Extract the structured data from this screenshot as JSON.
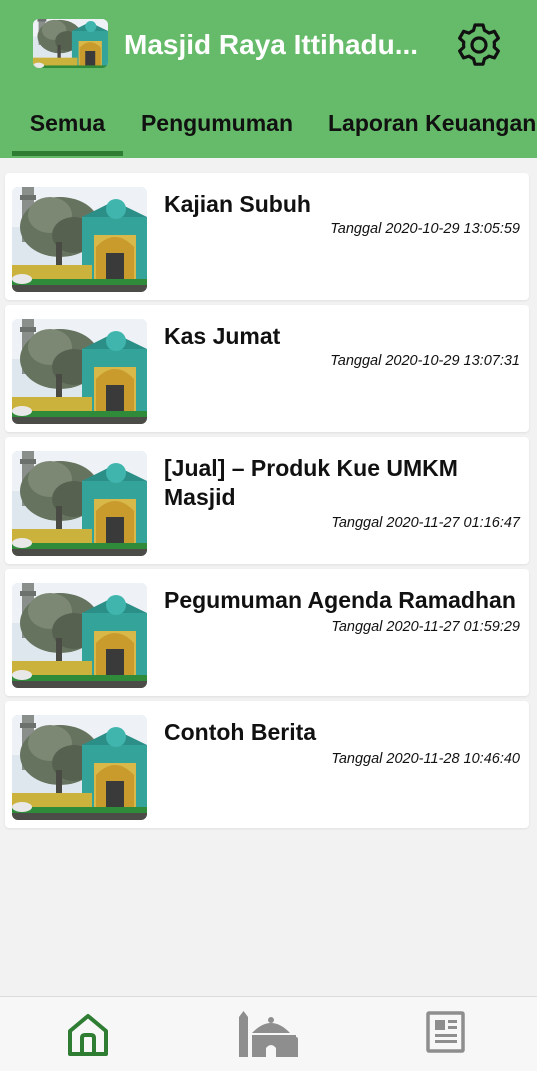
{
  "app": {
    "title": "Masjid Raya Ittihadu...",
    "logo_icon": "mosque-photo-icon",
    "settings_icon": "gear-icon",
    "bar_color": "#66bb6a",
    "indicator_color": "#2e7d32"
  },
  "tabs": [
    {
      "label": "Semua",
      "active": true
    },
    {
      "label": "Pengumuman",
      "active": false
    },
    {
      "label": "Laporan Keuangan",
      "active": false
    }
  ],
  "posts": [
    {
      "title": "Kajian Subuh",
      "date": "Tanggal 2020-10-29 13:05:59"
    },
    {
      "title": "Kas Jumat",
      "date": "Tanggal 2020-10-29 13:07:31"
    },
    {
      "title": "[Jual] –  Produk Kue UMKM Masjid",
      "date": "Tanggal 2020-11-27 01:16:47"
    },
    {
      "title": "Pegumuman Agenda Ramadhan",
      "date": "Tanggal 2020-11-27 01:59:29"
    },
    {
      "title": "Contoh Berita",
      "date": "Tanggal 2020-11-28 10:46:40"
    }
  ],
  "bottom_nav": [
    {
      "icon": "home-icon",
      "active": true
    },
    {
      "icon": "mosque-icon",
      "active": false
    },
    {
      "icon": "newspaper-icon",
      "active": false
    }
  ]
}
